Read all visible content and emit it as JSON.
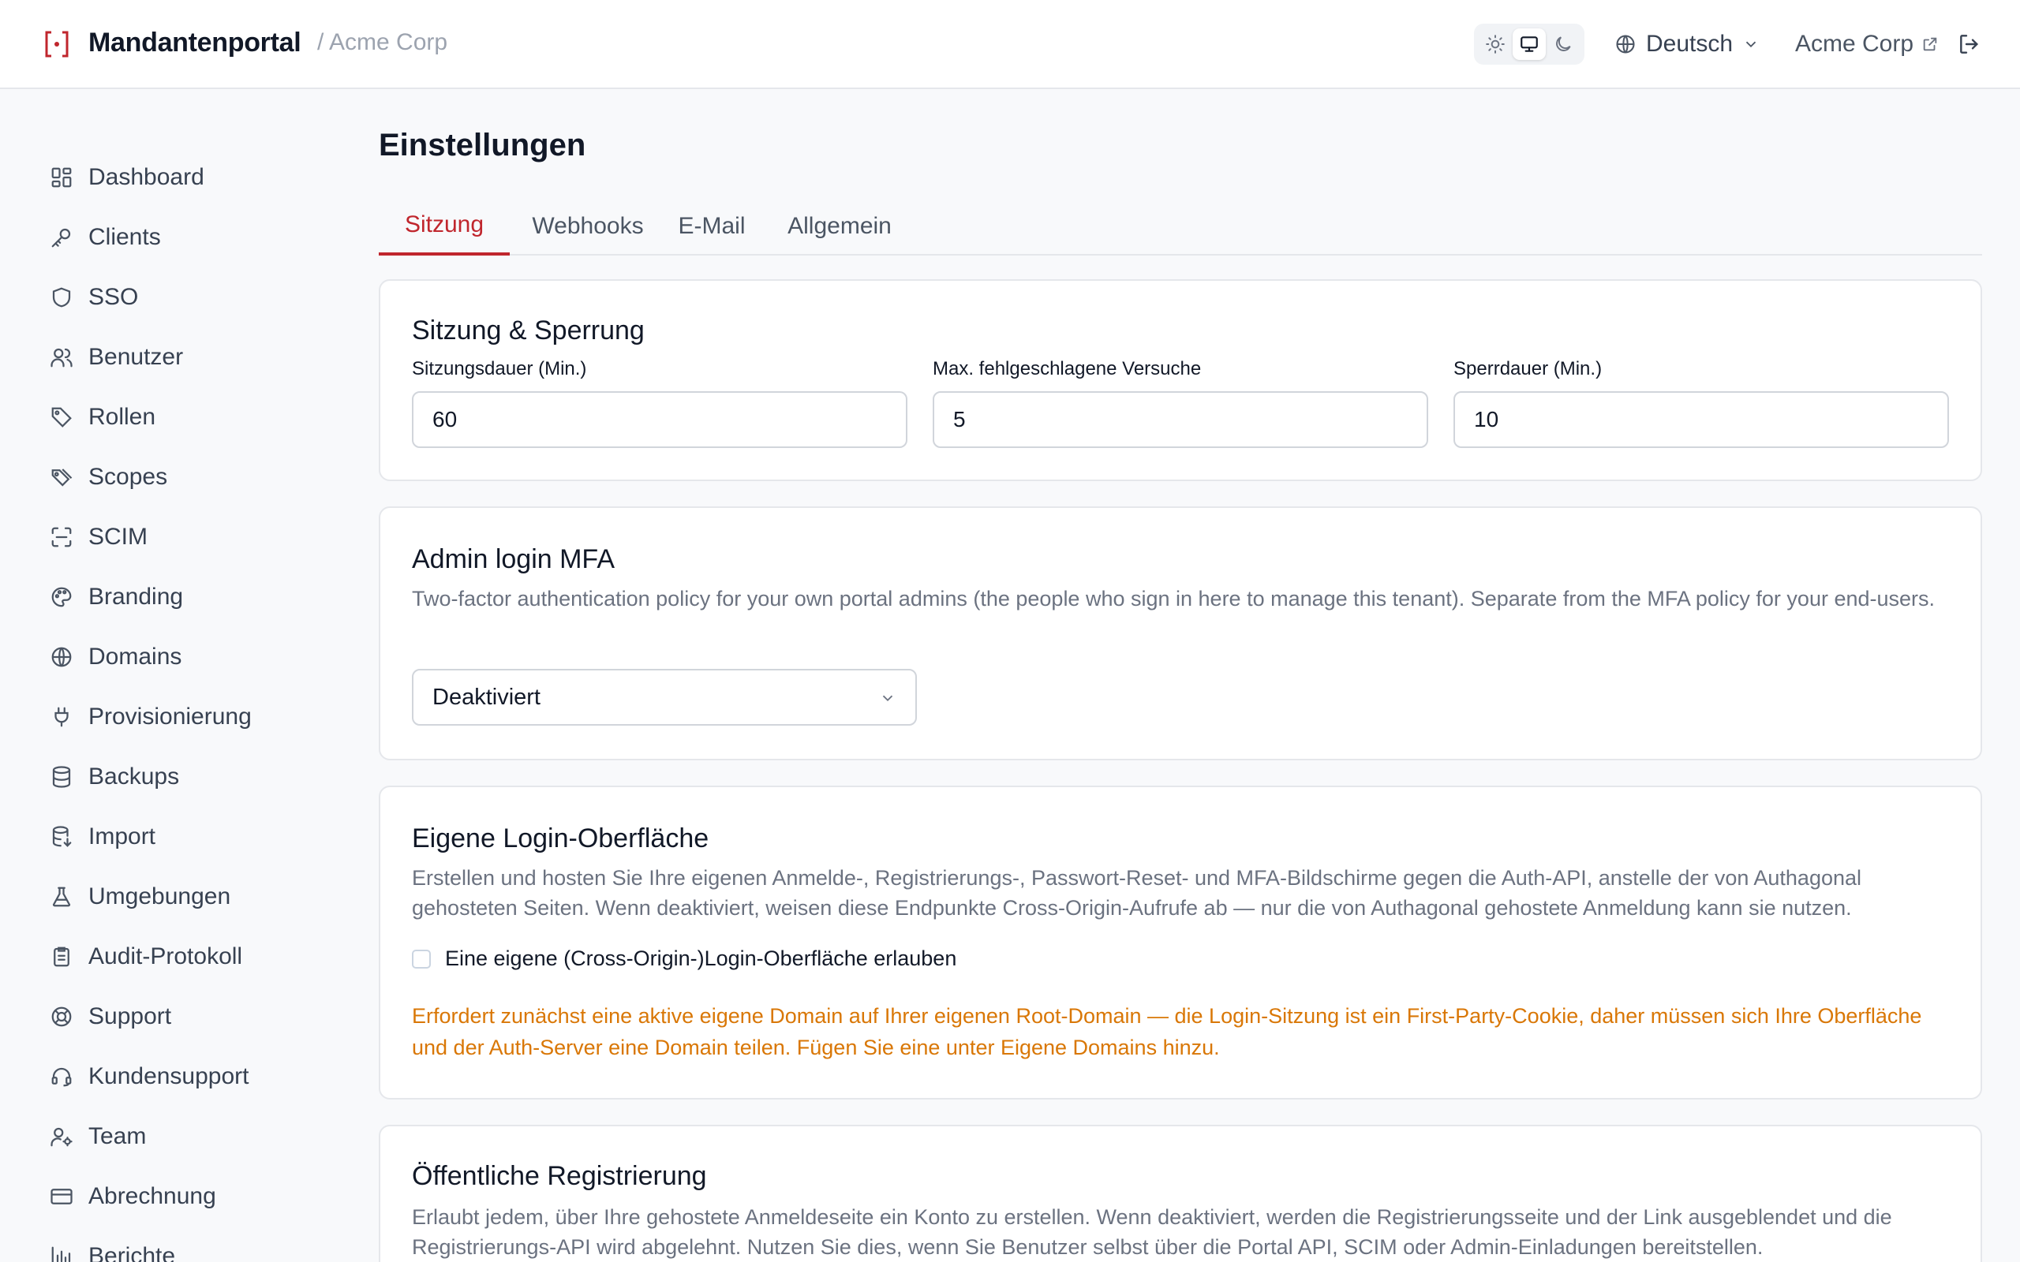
{
  "header": {
    "brand": "Mandantenportal",
    "tenant_crumb": "/ Acme Corp",
    "language": "Deutsch",
    "tenant_link": "Acme Corp"
  },
  "sidebar": {
    "items": [
      {
        "label": "Dashboard",
        "icon": "dashboard-icon"
      },
      {
        "label": "Clients",
        "icon": "key-icon"
      },
      {
        "label": "SSO",
        "icon": "shield-icon"
      },
      {
        "label": "Benutzer",
        "icon": "users-icon"
      },
      {
        "label": "Rollen",
        "icon": "tag-icon"
      },
      {
        "label": "Scopes",
        "icon": "tags-icon"
      },
      {
        "label": "SCIM",
        "icon": "scan-icon"
      },
      {
        "label": "Branding",
        "icon": "palette-icon"
      },
      {
        "label": "Domains",
        "icon": "globe-icon"
      },
      {
        "label": "Provisionierung",
        "icon": "plug-icon"
      },
      {
        "label": "Backups",
        "icon": "database-icon"
      },
      {
        "label": "Import",
        "icon": "database-import-icon"
      },
      {
        "label": "Umgebungen",
        "icon": "flask-icon"
      },
      {
        "label": "Audit-Protokoll",
        "icon": "clipboard-icon"
      },
      {
        "label": "Support",
        "icon": "lifebuoy-icon"
      },
      {
        "label": "Kundensupport",
        "icon": "headset-icon"
      },
      {
        "label": "Team",
        "icon": "user-cog-icon"
      },
      {
        "label": "Abrechnung",
        "icon": "credit-card-icon"
      },
      {
        "label": "Berichte",
        "icon": "bar-chart-icon"
      }
    ]
  },
  "main": {
    "title": "Einstellungen",
    "tabs": [
      {
        "label": "Sitzung",
        "active": true
      },
      {
        "label": "Webhooks",
        "active": false
      },
      {
        "label": "E-Mail",
        "active": false
      },
      {
        "label": "Allgemein",
        "active": false
      }
    ],
    "session": {
      "title": "Sitzung & Sperrung",
      "fields": [
        {
          "label": "Sitzungsdauer (Min.)",
          "value": "60"
        },
        {
          "label": "Max. fehlgeschlagene Versuche",
          "value": "5"
        },
        {
          "label": "Sperrdauer (Min.)",
          "value": "10"
        }
      ]
    },
    "mfa": {
      "title": "Admin login MFA",
      "description": "Two-factor authentication policy for your own portal admins (the people who sign in here to manage this tenant). Separate from the MFA policy for your end-users.",
      "selected": "Deaktiviert"
    },
    "custom_login": {
      "title": "Eigene Login-Oberfläche",
      "description": "Erstellen und hosten Sie Ihre eigenen Anmelde-, Registrierungs-, Passwort-Reset- und MFA-Bildschirme gegen die Auth-API, anstelle der von Authagonal gehosteten Seiten. Wenn deaktiviert, weisen diese Endpunkte Cross-Origin-Aufrufe ab — nur die von Authagonal gehostete Anmeldung kann sie nutzen.",
      "checkbox_label": "Eine eigene (Cross-Origin-)Login-Oberfläche erlauben",
      "checked": false,
      "warning": "Erfordert zunächst eine aktive eigene Domain auf Ihrer eigenen Root-Domain — die Login-Sitzung ist ein First-Party-Cookie, daher müssen sich Ihre Oberfläche und der Auth-Server eine Domain teilen. Fügen Sie eine unter Eigene Domains hinzu."
    },
    "registration": {
      "title": "Öffentliche Registrierung",
      "description": "Erlaubt jedem, über Ihre gehostete Anmeldeseite ein Konto zu erstellen. Wenn deaktiviert, werden die Registrierungsseite und der Link ausgeblendet und die Registrierungs-API wird abgelehnt. Nutzen Sie dies, wenn Sie Benutzer selbst über die Portal API, SCIM oder Admin-Einladungen bereitstellen."
    },
    "colors": {
      "accent": "#c0262d",
      "warning": "#d97706"
    }
  }
}
